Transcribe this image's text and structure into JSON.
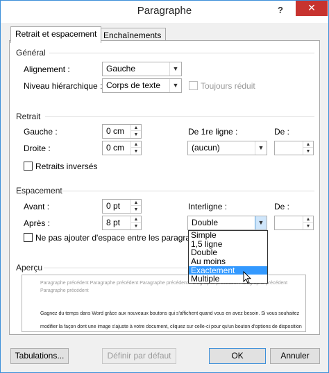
{
  "window": {
    "title": "Paragraphe",
    "help_label": "?",
    "close_label": "✕"
  },
  "tabs": [
    {
      "label": "Retrait et espacement"
    },
    {
      "label": "Enchaînements"
    }
  ],
  "general": {
    "section_label": "Général",
    "alignment_label": "Alignement :",
    "alignment_value": "Gauche",
    "level_label": "Niveau hiérarchique :",
    "level_value": "Corps de texte",
    "collapsed_label": "Toujours réduit"
  },
  "indent": {
    "section_label": "Retrait",
    "left_label": "Gauche :",
    "left_value": "0 cm",
    "right_label": "Droite :",
    "right_value": "0 cm",
    "special_label": "De 1re ligne :",
    "special_value": "(aucun)",
    "by_label": "De :",
    "by_value": "",
    "mirror_label": "Retraits inversés"
  },
  "spacing": {
    "section_label": "Espacement",
    "before_label": "Avant :",
    "before_value": "0 pt",
    "after_label": "Après :",
    "after_value": "8 pt",
    "line_label": "Interligne :",
    "line_value": "Double",
    "at_label": "De :",
    "at_value": "",
    "no_space_label": "Ne pas ajouter d'espace entre les paragraph",
    "line_options": [
      "Simple",
      "1,5 ligne",
      "Double",
      "Au moins",
      "Exactement",
      "Multiple"
    ],
    "highlighted_option": "Exactement"
  },
  "preview": {
    "section_label": "Aperçu",
    "previous_text": "Paragraphe précédent Paragraphe précédent Paragraphe précédent Paragraphe précédent Paragraphe précédent",
    "previous_text_2": "Paragraphe précédent",
    "sample_line_1": "Gagnez du temps dans Word grâce aux nouveaux boutons qui s'affichent quand vous en avez besoin. Si vous souhaitez",
    "sample_line_2": "modifier la façon dont une image s'ajuste à votre document, cliquez sur celle-ci pour qu'un bouton d'options de disposition"
  },
  "buttons": {
    "tabs_label": "Tabulations...",
    "default_label": "Définir par défaut",
    "ok_label": "OK",
    "cancel_label": "Annuler"
  }
}
